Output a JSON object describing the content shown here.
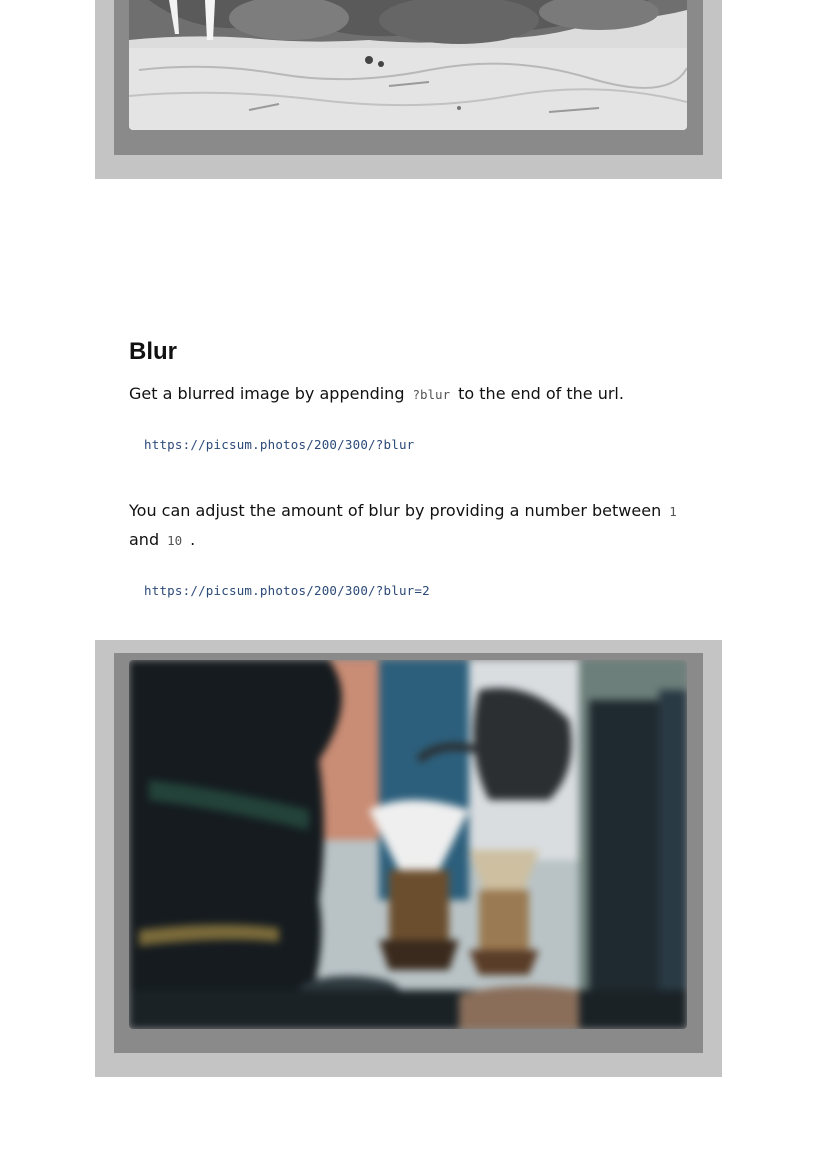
{
  "section": {
    "title": "Blur",
    "para1": {
      "before": "Get a blurred image by appending",
      "code": "?blur",
      "after": "to the end of the url."
    },
    "example1_url": "https://picsum.photos/200/300/?blur",
    "para2": {
      "before": "You can adjust the amount of blur by providing a number between",
      "code_min": "1",
      "middle": "and",
      "code_max": "10",
      "after": "."
    },
    "example2_url": "https://picsum.photos/200/300/?blur=2"
  },
  "images": {
    "top": {
      "subject": "walrus-photo",
      "style": "black-and-white"
    },
    "bottom": {
      "subject": "coffee-brewing-photo",
      "style": "blurred"
    }
  },
  "colors": {
    "frame_outer": "#c4c4c4",
    "frame_inner": "#8a8a8a",
    "code_link": "#2c4a78"
  }
}
